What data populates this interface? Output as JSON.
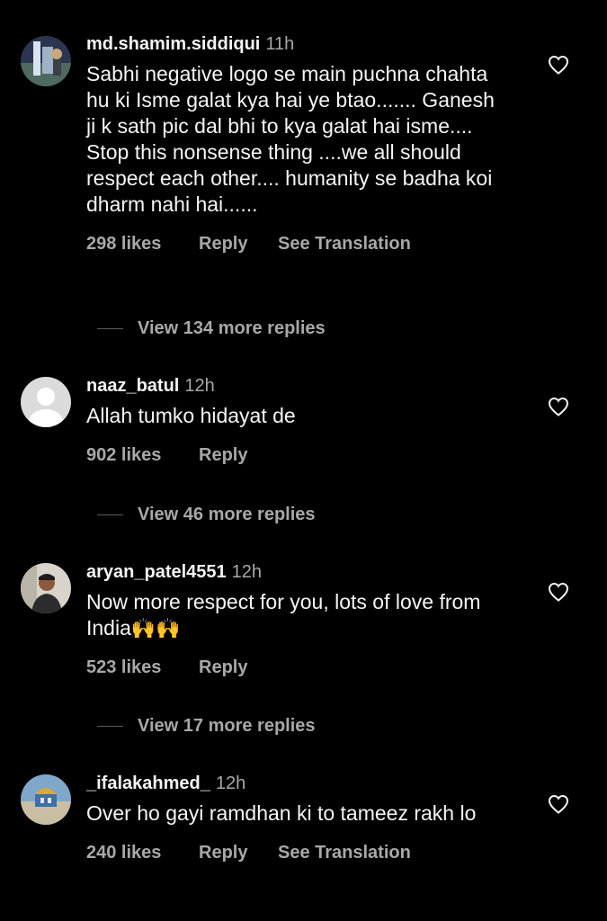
{
  "comments": [
    {
      "username": "md.shamim.siddiqui",
      "time": "11h",
      "text": "Sabhi negative logo se main puchna chahta hu ki Isme galat kya hai ye btao....... Ganesh ji k sath pic dal bhi to kya galat hai isme.... Stop this nonsense thing ....we all should respect each other.... humanity  se badha koi dharm nahi hai......",
      "likes": "298 likes",
      "reply": "Reply",
      "translation": "See Translation",
      "view_replies": "View 134 more replies",
      "avatar_icon": "profile-photo-icon"
    },
    {
      "username": "naaz_batul",
      "time": "12h",
      "text": "Allah tumko hidayat de",
      "likes": "902 likes",
      "reply": "Reply",
      "view_replies": "View 46 more replies",
      "avatar_icon": "default-avatar-icon"
    },
    {
      "username": "aryan_patel4551",
      "time": "12h",
      "text": "Now more respect for you, lots of love from India",
      "text_emoji": "🙌🙌",
      "likes": "523 likes",
      "reply": "Reply",
      "view_replies": "View 17 more replies",
      "avatar_icon": "profile-photo-icon"
    },
    {
      "username": "_ifalakahmed_",
      "time": "12h",
      "text": "Over ho gayi ramdhan ki to tameez rakh lo",
      "likes": "240 likes",
      "reply": "Reply",
      "translation": "See Translation",
      "avatar_icon": "profile-photo-icon"
    }
  ],
  "colors": {
    "background": "#000000",
    "primary_text": "#f5f5f5",
    "secondary_text": "#a8a8a8"
  },
  "icons": {
    "like": "heart-outline-icon"
  }
}
